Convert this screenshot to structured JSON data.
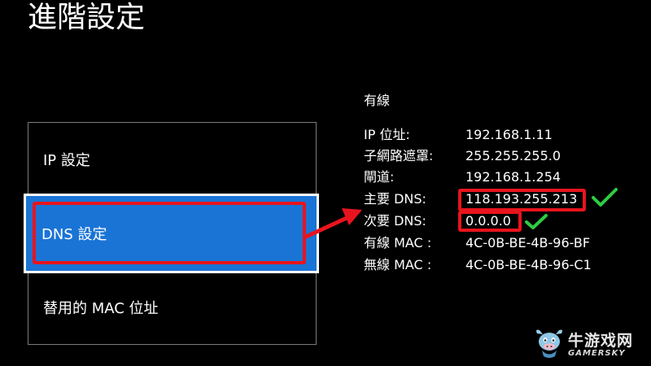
{
  "page": {
    "title": "進階設定"
  },
  "menu": {
    "items": [
      {
        "label": "IP 設定",
        "selected": false
      },
      {
        "label": "DNS 設定",
        "selected": true
      },
      {
        "label": "替用的 MAC 位址",
        "selected": false
      }
    ]
  },
  "info": {
    "header": "有線",
    "rows": [
      {
        "label": "IP 位址:",
        "value": "192.168.1.11"
      },
      {
        "label": "子網路遮罩:",
        "value": "255.255.255.0"
      },
      {
        "label": "閘道:",
        "value": "192.168.1.254"
      },
      {
        "label": "主要 DNS:",
        "value": "118.193.255.213"
      },
      {
        "label": "次要 DNS:",
        "value": "0.0.0.0"
      },
      {
        "label": "有線 MAC :",
        "value": "4C-0B-BE-4B-96-BF"
      },
      {
        "label": "無線 MAC :",
        "value": "4C-0B-BE-4B-96-C1"
      }
    ]
  },
  "annotations": {
    "highlight_color": "#e8141d",
    "check_color": "#2ecc40",
    "selected_bg": "#1a74d6"
  },
  "watermark": {
    "text_cn": "牛游戏网",
    "text_en": "GAMERSKY",
    "icon": "bull-mascot-icon"
  }
}
